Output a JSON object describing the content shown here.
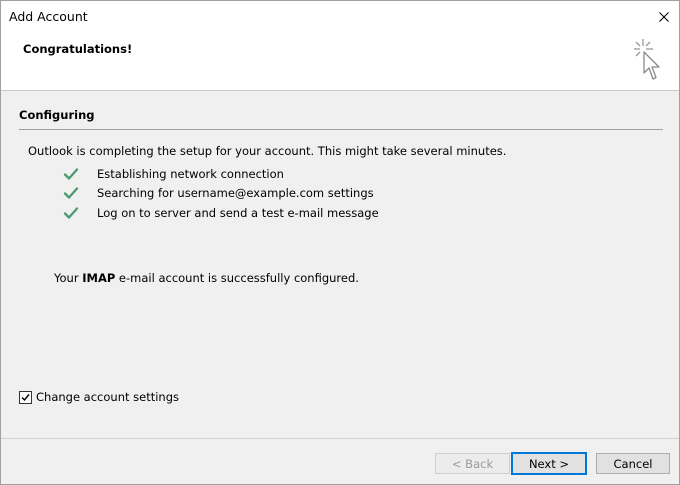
{
  "window": {
    "title": "Add Account"
  },
  "header": {
    "title": "Congratulations!"
  },
  "section": {
    "title": "Configuring",
    "intro": "Outlook is completing the setup for your account. This might take several minutes."
  },
  "steps": [
    {
      "label": "Establishing network connection",
      "status": "done"
    },
    {
      "label": "Searching for username@example.com settings",
      "status": "done"
    },
    {
      "label": "Log on to server and send a test e-mail message",
      "status": "done"
    }
  ],
  "result": {
    "prefix": "Your ",
    "account_type": "IMAP",
    "suffix": " e-mail account is successfully configured."
  },
  "options": {
    "change_settings_label": "Change account settings",
    "change_settings_checked": true
  },
  "buttons": {
    "back_label": "< Back",
    "next_label": "Next >",
    "cancel_label": "Cancel"
  },
  "colors": {
    "check": "#4c9a6e",
    "focus_border": "#0078d7"
  },
  "icons": {
    "close": "close-icon",
    "wizard": "cursor-sparkle-icon",
    "check": "check-icon"
  }
}
